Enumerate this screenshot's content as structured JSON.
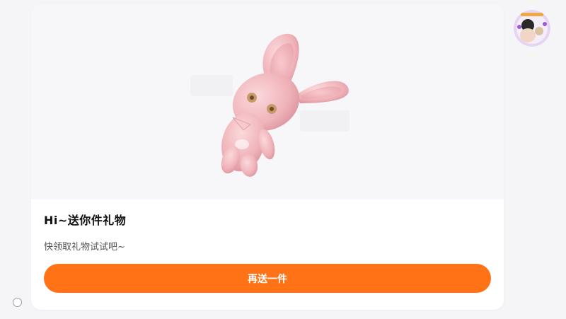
{
  "card": {
    "title": "Hi~送你件礼物",
    "subtitle": "快领取礼物试试吧~",
    "button_label": "再送一件",
    "image_icon": "pink-bunny-plush",
    "accent_color": "#ff7216"
  },
  "user": {
    "avatar_icon": "user-avatar"
  },
  "colors": {
    "background": "#f5f5f7",
    "card": "#ffffff",
    "button": "#ff7216",
    "bunny": "#f2b8be"
  }
}
